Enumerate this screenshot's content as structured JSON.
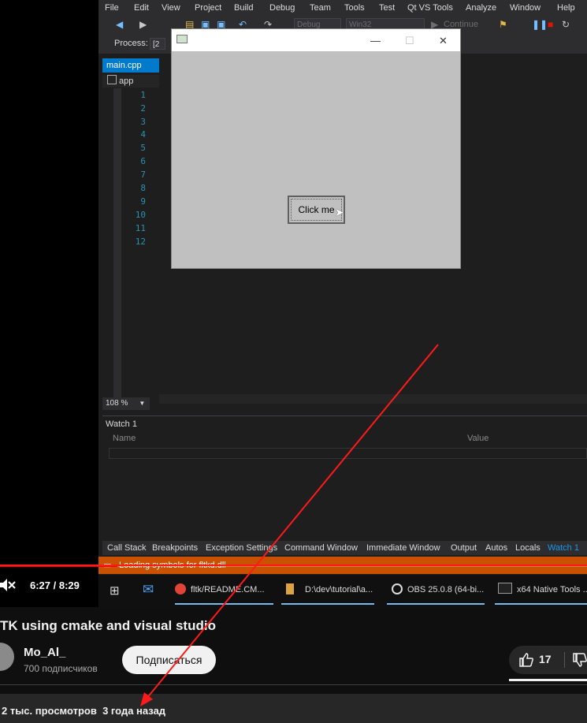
{
  "vs": {
    "menu": [
      "File",
      "Edit",
      "View",
      "Project",
      "Build",
      "Debug",
      "Team",
      "Tools",
      "Test",
      "Qt VS Tools",
      "Analyze",
      "Window",
      "Help"
    ],
    "toolbar": {
      "config": "Debug",
      "platform": "Win32",
      "continue_label": "Continue"
    },
    "process_label": "Process:",
    "editor_tab": "main.cpp",
    "nav_scope": "app",
    "line_numbers": [
      "1",
      "2",
      "3",
      "4",
      "5",
      "6",
      "7",
      "8",
      "9",
      "10",
      "11",
      "12"
    ],
    "zoom": "108 %",
    "watch": {
      "title": "Watch 1",
      "col_name": "Name",
      "col_value": "Value"
    },
    "bottom_tabs": [
      "Call Stack",
      "Breakpoints",
      "Exception Settings",
      "Command Window",
      "Immediate Window",
      "Output",
      "Autos",
      "Locals",
      "Watch 1"
    ],
    "status": "Loading symbols for fltkd.dll",
    "taskbar": [
      "fltk/README.CM...",
      "D:\\dev\\tutorial\\a...",
      "OBS 25.0.8 (64-bi...",
      "x64 Native Tools ..."
    ]
  },
  "fltk_window": {
    "button_label": "Click me"
  },
  "player": {
    "time": "6:27 / 8:29",
    "progress": 0.2
  },
  "video": {
    "title": "TK using cmake and visual studio",
    "channel": "Mo_Al_",
    "subscribers": "700 подписчиков",
    "subscribe_label": "Подписаться",
    "likes": "17",
    "views": "2 тыс. просмотров",
    "age": "3 года назад"
  },
  "colors": {
    "accent_red": "#ff0000",
    "vs_blue": "#007acc",
    "status_orange": "#ca5100"
  }
}
